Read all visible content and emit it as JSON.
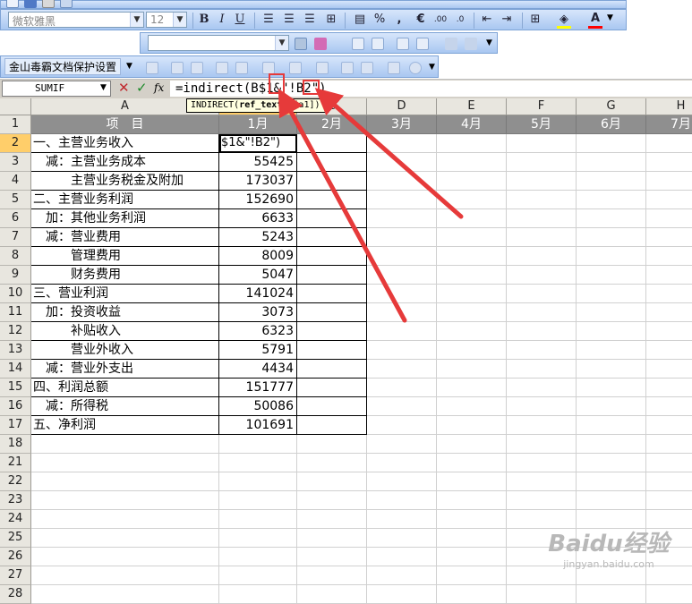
{
  "toolbars": {
    "font_name": "微软雅黑",
    "font_size": "12",
    "bold": "B",
    "italic": "I",
    "underline": "U",
    "percent": "%",
    "comma": ",",
    "currency": "€",
    "font_color_glyph": "A",
    "protect_toolbar_label": "金山毒霸文档保护设置"
  },
  "formula_bar": {
    "name_box": "SUMIF",
    "cancel_glyph": "✕",
    "enter_glyph": "✓",
    "fx_label": "fx",
    "formula": "=indirect(B$1&\"!B2\")"
  },
  "tooltip": {
    "fn": "INDIRECT(",
    "arg1": "ref_text",
    "rest": ", [a1])"
  },
  "columns": [
    "A",
    "B",
    "C",
    "D",
    "E",
    "F",
    "G",
    "H"
  ],
  "rows": [
    "1",
    "2",
    "3",
    "4",
    "5",
    "6",
    "7",
    "8",
    "9",
    "10",
    "11",
    "12",
    "13",
    "14",
    "15",
    "16",
    "17",
    "18",
    "21",
    "22",
    "23",
    "24",
    "25",
    "26",
    "27",
    "28"
  ],
  "header_row": {
    "a": "项　目",
    "months": [
      "1月",
      "2月",
      "3月",
      "4月",
      "5月",
      "6月",
      "7月"
    ]
  },
  "b2_editing": "$1&\"!B2\")",
  "items": [
    {
      "label": "一、主营业务收入",
      "value": ""
    },
    {
      "label": "　减：主营业务成本",
      "value": "55425"
    },
    {
      "label": "　　　主营业务税金及附加",
      "value": "173037"
    },
    {
      "label": "二、主营业务利润",
      "value": "152690"
    },
    {
      "label": "　加：其他业务利润",
      "value": "6633"
    },
    {
      "label": "　减：营业费用",
      "value": "5243"
    },
    {
      "label": "　　　管理费用",
      "value": "8009"
    },
    {
      "label": "　　　财务费用",
      "value": "5047"
    },
    {
      "label": "三、营业利润",
      "value": "141024"
    },
    {
      "label": "　加：投资收益",
      "value": "3073"
    },
    {
      "label": "　　　补贴收入",
      "value": "6323"
    },
    {
      "label": "　　　营业外收入",
      "value": "5791"
    },
    {
      "label": "　减：营业外支出",
      "value": "4434"
    },
    {
      "label": "四、利润总额",
      "value": "151777"
    },
    {
      "label": "　减：所得税",
      "value": "50086"
    },
    {
      "label": "五、净利润",
      "value": "101691"
    }
  ],
  "watermark": {
    "brand": "Baidu经验",
    "url": "jingyan.baidu.com"
  },
  "colors": {
    "toolbar": "#b9d1f5",
    "header_fill": "#8f8f8f",
    "selected_header": "#ffce6a",
    "annotation": "#e63a3a"
  }
}
